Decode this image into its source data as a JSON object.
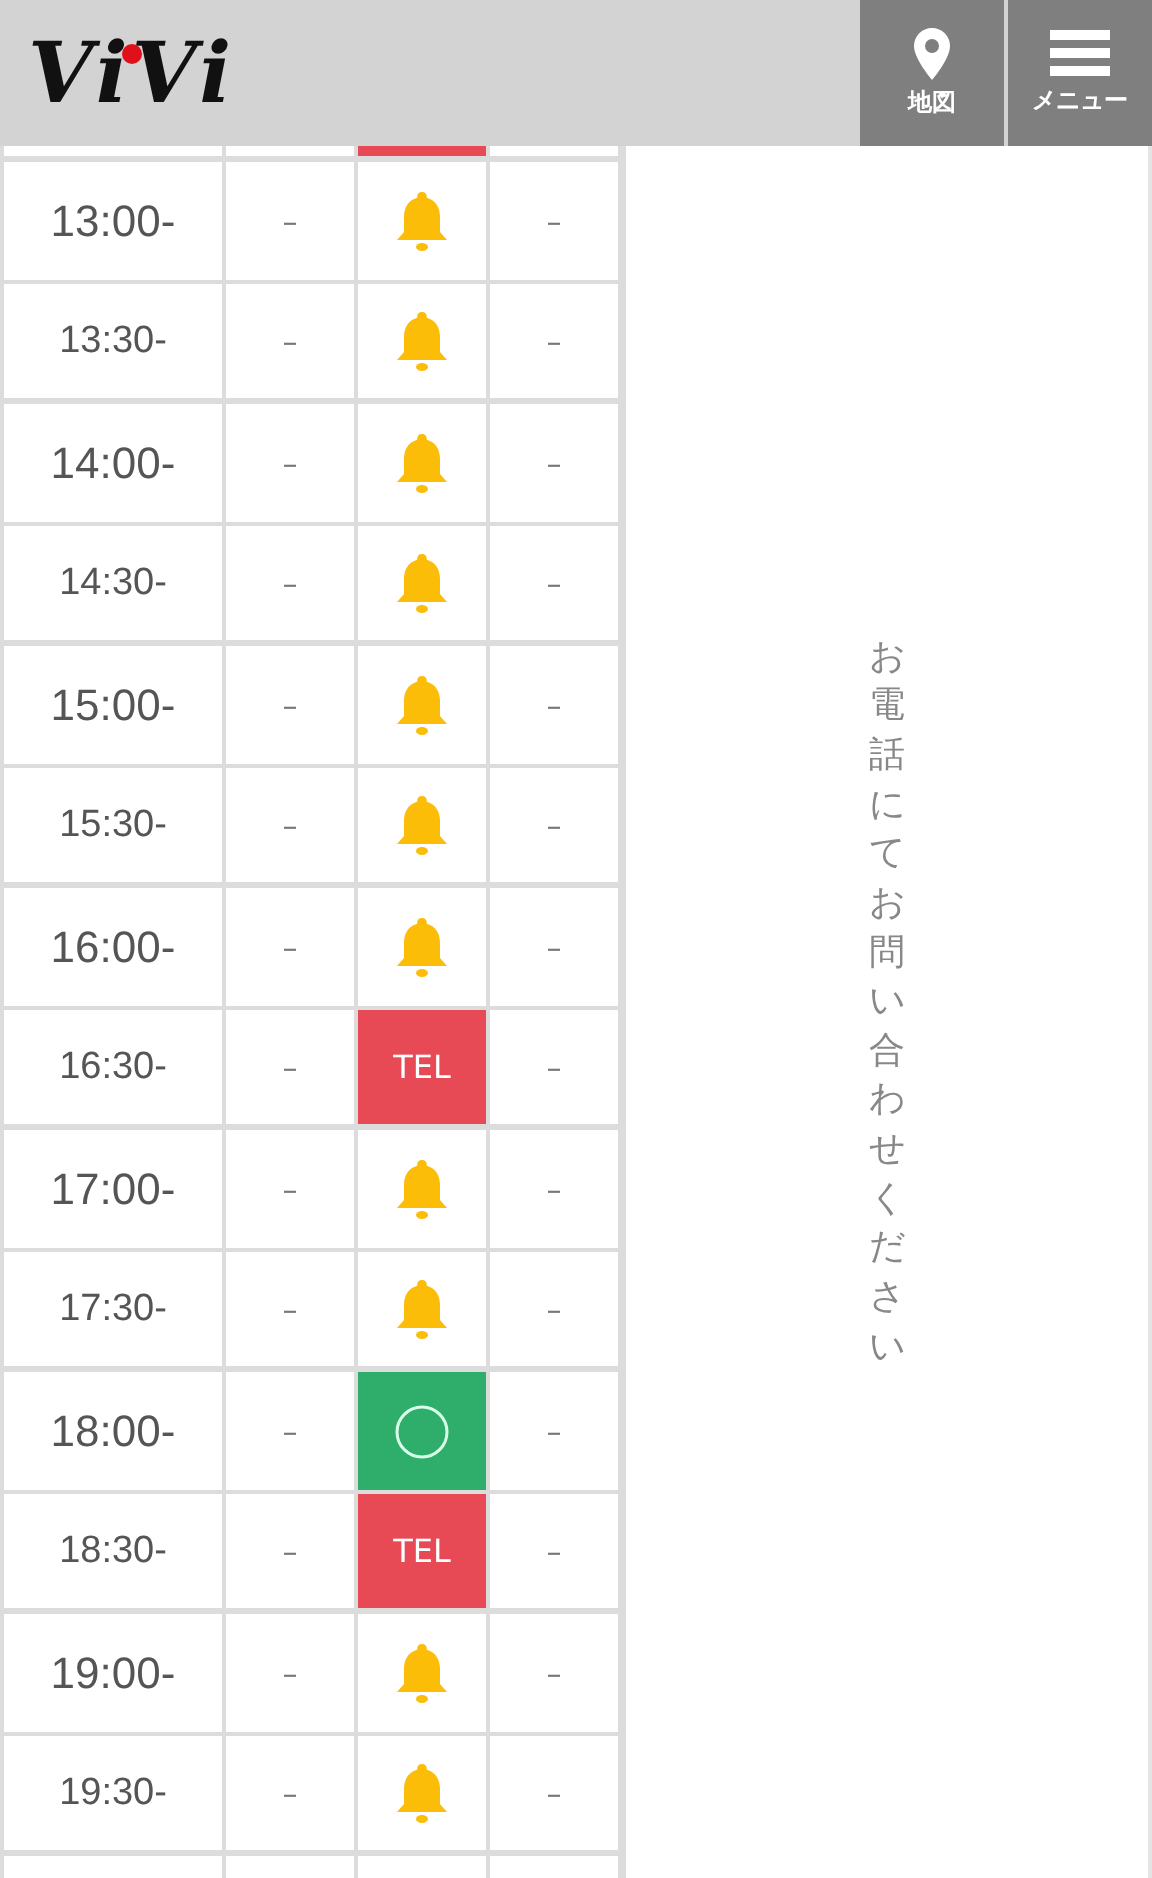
{
  "header": {
    "logo": "ViVi",
    "buttons": [
      {
        "kind": "map",
        "label": "地図"
      },
      {
        "kind": "menu",
        "label": "メニュー"
      }
    ]
  },
  "table": {
    "top_edge_slots": [
      {
        "kind": "empty"
      },
      {
        "kind": "tel"
      },
      {
        "kind": "empty"
      }
    ],
    "rows": [
      {
        "time": "13:00-",
        "hour": true,
        "slots": [
          {
            "kind": "dash",
            "text": "–"
          },
          {
            "kind": "bell"
          },
          {
            "kind": "dash",
            "text": "–"
          }
        ]
      },
      {
        "time": "13:30-",
        "hour": false,
        "slots": [
          {
            "kind": "dash",
            "text": "–"
          },
          {
            "kind": "bell"
          },
          {
            "kind": "dash",
            "text": "–"
          }
        ]
      },
      {
        "time": "14:00-",
        "hour": true,
        "slots": [
          {
            "kind": "dash",
            "text": "–"
          },
          {
            "kind": "bell"
          },
          {
            "kind": "dash",
            "text": "–"
          }
        ]
      },
      {
        "time": "14:30-",
        "hour": false,
        "slots": [
          {
            "kind": "dash",
            "text": "–"
          },
          {
            "kind": "bell"
          },
          {
            "kind": "dash",
            "text": "–"
          }
        ]
      },
      {
        "time": "15:00-",
        "hour": true,
        "slots": [
          {
            "kind": "dash",
            "text": "–"
          },
          {
            "kind": "bell"
          },
          {
            "kind": "dash",
            "text": "–"
          }
        ]
      },
      {
        "time": "15:30-",
        "hour": false,
        "slots": [
          {
            "kind": "dash",
            "text": "–"
          },
          {
            "kind": "bell"
          },
          {
            "kind": "dash",
            "text": "–"
          }
        ]
      },
      {
        "time": "16:00-",
        "hour": true,
        "slots": [
          {
            "kind": "dash",
            "text": "–"
          },
          {
            "kind": "bell"
          },
          {
            "kind": "dash",
            "text": "–"
          }
        ]
      },
      {
        "time": "16:30-",
        "hour": false,
        "slots": [
          {
            "kind": "dash",
            "text": "–"
          },
          {
            "kind": "tel",
            "text": "TEL"
          },
          {
            "kind": "dash",
            "text": "–"
          }
        ]
      },
      {
        "time": "17:00-",
        "hour": true,
        "slots": [
          {
            "kind": "dash",
            "text": "–"
          },
          {
            "kind": "bell"
          },
          {
            "kind": "dash",
            "text": "–"
          }
        ]
      },
      {
        "time": "17:30-",
        "hour": false,
        "slots": [
          {
            "kind": "dash",
            "text": "–"
          },
          {
            "kind": "bell"
          },
          {
            "kind": "dash",
            "text": "–"
          }
        ]
      },
      {
        "time": "18:00-",
        "hour": true,
        "slots": [
          {
            "kind": "dash",
            "text": "–"
          },
          {
            "kind": "ok"
          },
          {
            "kind": "dash",
            "text": "–"
          }
        ]
      },
      {
        "time": "18:30-",
        "hour": false,
        "slots": [
          {
            "kind": "dash",
            "text": "–"
          },
          {
            "kind": "tel",
            "text": "TEL"
          },
          {
            "kind": "dash",
            "text": "–"
          }
        ]
      },
      {
        "time": "19:00-",
        "hour": true,
        "slots": [
          {
            "kind": "dash",
            "text": "–"
          },
          {
            "kind": "bell"
          },
          {
            "kind": "dash",
            "text": "–"
          }
        ]
      },
      {
        "time": "19:30-",
        "hour": false,
        "slots": [
          {
            "kind": "dash",
            "text": "–"
          },
          {
            "kind": "bell"
          },
          {
            "kind": "dash",
            "text": "–"
          }
        ]
      }
    ]
  },
  "side_note": "お電話にてお問い合わせください"
}
